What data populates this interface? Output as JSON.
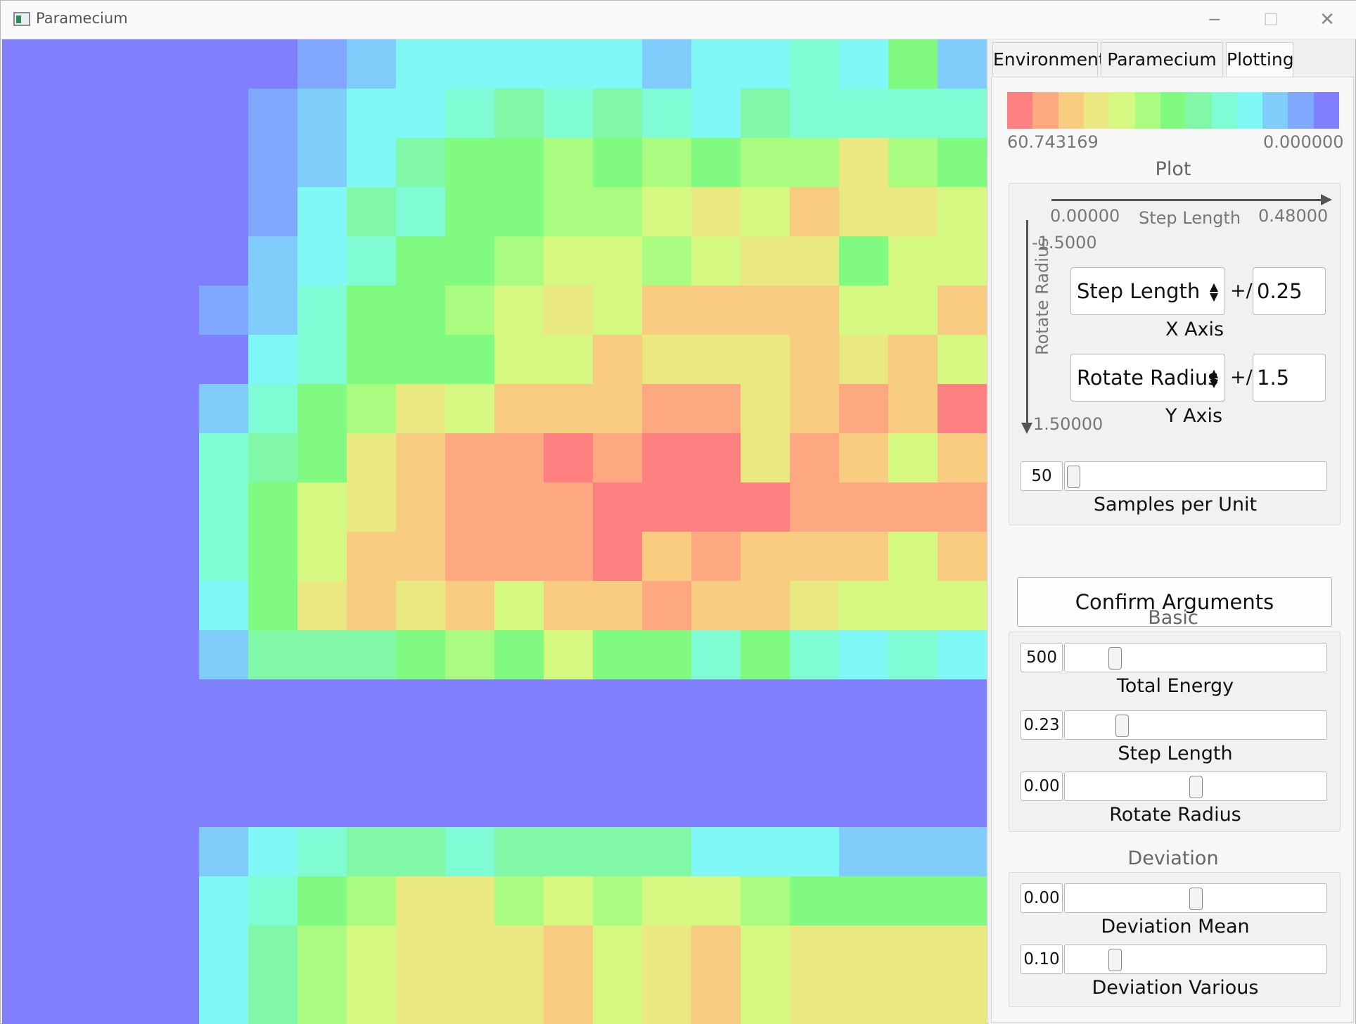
{
  "window": {
    "title": "Paramecium",
    "minimize_glyph": "─",
    "maximize_glyph": "☐",
    "close_glyph": "✕"
  },
  "tabs": [
    {
      "label": "Environment",
      "active": false
    },
    {
      "label": "Paramecium",
      "active": false
    },
    {
      "label": "Plotting",
      "active": true
    }
  ],
  "palette": {
    "R": "#ff8080",
    "Q": "#fda880",
    "P": "#f8cc80",
    "O": "#eae880",
    "N": "#d4f880",
    "M": "#aafc80",
    "L": "#80fa80",
    "K": "#80f8a8",
    "J": "#80fcd4",
    "I": "#80f8f6",
    "H": "#80ccfa",
    "G": "#80a8fc",
    "B": "#8080ff"
  },
  "colorbar": {
    "colors": [
      "#ff8080",
      "#fda880",
      "#f8cc80",
      "#eae880",
      "#d4f880",
      "#aafc80",
      "#80fa80",
      "#80f8a8",
      "#80fcd4",
      "#80f8f6",
      "#80ccfa",
      "#80a8fc",
      "#8080ff"
    ],
    "max_label": "60.743169",
    "min_label": "0.000000"
  },
  "heatmap": {
    "rows": [
      "BBBBBBGHIIIIIHIIJILH",
      "BBBBBGHIIJKJKJIKJJJJ",
      "BBBBBGHIKLLMLMLMMOML",
      "BBBBBGIKJLLMMNONPOON",
      "BBBBBHIJLLMNNMNOOLNN",
      "BBBBGHJLLMNONPPPPNNP",
      "BBBBBIJLLLNNPOOOPOPN",
      "BBBBHJLMONPPPQQOPQPR",
      "BBBBJKLOPQQRQRROQPNP",
      "BBBBJLNOPQQQRRRRQQQQ",
      "BBBBJLNPPQQQRPQPPPNP",
      "BBBBILOPOPNPPQPPONNN",
      "BBBBHKKKLMLNLLJLJIJI",
      "BBBBBBBBBBBBBBBBBBBB",
      "BBBBBBBBBBBBBBBBBBBB",
      "BBBBBBBBBBBBBBBBBBBB",
      "BBBBHIJKKJKKKKIIIHHH",
      "BBBBIJLMOOMNMNNMLLLL",
      "BBBBIKMNOOOPNOPNOOOO",
      "BBBBIKMNOOOPNOPNOOOO"
    ]
  },
  "plot": {
    "title": "Plot",
    "x_min": "0.00000",
    "x_max": "0.48000",
    "x_label": "Step Length",
    "y_min": "-1.5000",
    "y_max": "1.50000",
    "y_label": "Rotate Radius",
    "x_select": "Step Length",
    "x_tolerance": "0.25",
    "x_caption": "X Axis",
    "y_select": "Rotate Radius",
    "y_tolerance": "1.5",
    "y_caption": "Y Axis",
    "plus_minus": "+/-",
    "samples_value": "50",
    "samples_fraction": 0.0,
    "samples_caption": "Samples per Unit"
  },
  "confirm_label": "Confirm Arguments",
  "basic": {
    "title": "Basic",
    "total_energy": {
      "value": "500",
      "fraction": 0.17,
      "label": "Total Energy"
    },
    "step_length": {
      "value": "0.23",
      "fraction": 0.2,
      "label": "Step Length"
    },
    "rotate_radius": {
      "value": "0.00",
      "fraction": 0.5,
      "label": "Rotate Radius"
    }
  },
  "deviation": {
    "title": "Deviation",
    "mean": {
      "value": "0.00",
      "fraction": 0.5,
      "label": "Deviation Mean"
    },
    "various": {
      "value": "0.10",
      "fraction": 0.17,
      "label": "Deviation Various"
    }
  }
}
